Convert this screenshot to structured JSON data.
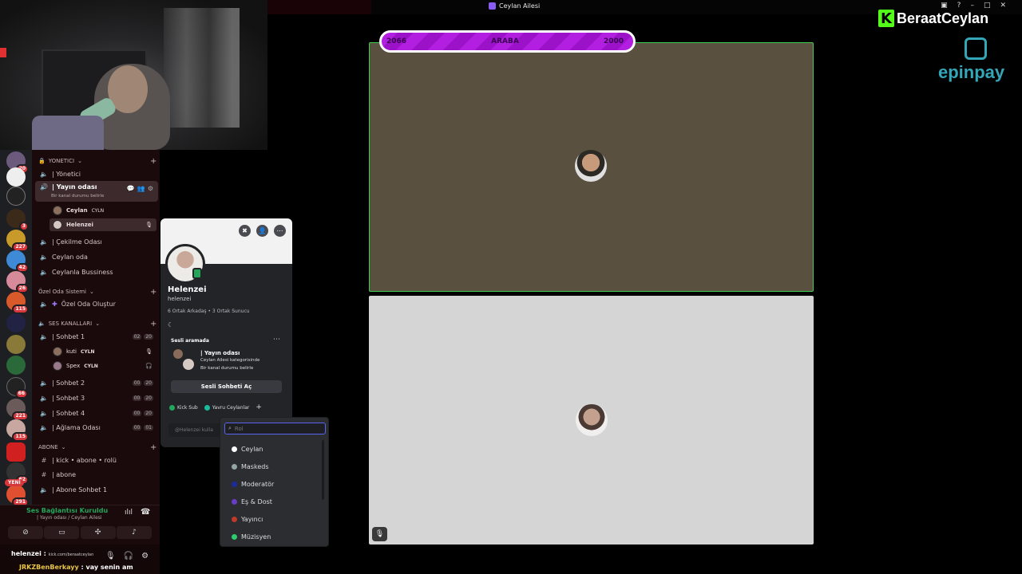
{
  "window": {
    "title": "Ceylan Ailesi"
  },
  "channels": {
    "cat_yonetici": "YONETICI",
    "ch_yonetici": "| Yönetici",
    "ch_yayin": "| Yayın odası",
    "ch_yayin_status": "Bir kanal durumu belirle",
    "member1": "Ceylan",
    "member1_tag": "CYLN",
    "member2": "Helenzei",
    "ch_cekilme": "| Çekilme Odası",
    "ch_ceylan_oda": "Ceylan oda",
    "ch_bussiness": "Ceylanla Bussiness",
    "cat_ozel": "Özel Oda Sistemi",
    "ch_ozel": "Özel Oda Oluştur",
    "cat_ses": "SES KANALLARI",
    "ch_sohbet1": "| Sohbet 1",
    "ch_sohbet1_cnt_a": "02",
    "ch_sohbet1_cnt_b": "20",
    "member3": "kuti",
    "member3_tag": "CYLN",
    "member4": "Spex",
    "member4_tag": "CYLN",
    "ch_sohbet2": "| Sohbet 2",
    "ch_sohbet2_cnt_a": "00",
    "ch_sohbet2_cnt_b": "20",
    "ch_sohbet3": "| Sohbet 3",
    "ch_sohbet3_cnt_a": "00",
    "ch_sohbet3_cnt_b": "20",
    "ch_sohbet4": "| Sohbet 4",
    "ch_sohbet4_cnt_a": "00",
    "ch_sohbet4_cnt_b": "20",
    "ch_aglama": "| Ağlama Odası",
    "ch_aglama_cnt_a": "00",
    "ch_aglama_cnt_b": "01",
    "cat_abone": "ABONE",
    "ch_kick": "| kick • abone • rolü",
    "ch_abone": "| abone",
    "ch_abone_sohbet": "| Abone Sohbet 1"
  },
  "rail": {
    "badges": [
      "20",
      "3",
      "227",
      "42",
      "26",
      "115",
      "66",
      "221",
      "115",
      "62",
      "291"
    ],
    "new_label": "YENİ"
  },
  "voice": {
    "status": "Ses Bağlantısı Kuruldu",
    "location": "| Yayın odası / Ceylan Ailesi"
  },
  "chat": {
    "line1_user": "helenzei :",
    "line1_url": "kick.com/beraatceylan",
    "line2_user": "JRKZBenBerkayy",
    "line2_msg": ": vay senin am"
  },
  "profile": {
    "name": "Helenzei",
    "username": "helenzei",
    "mutual": "6 Ortak Arkadaş • 3 Ortak Sunucu",
    "section": "Sesli aramada",
    "call_channel": "| Yayın odası",
    "call_category": "Ceylan Ailesi kategorisinde",
    "call_status": "Bir kanal durumu belirle",
    "join_button": "Sesli Sohbeti Aç",
    "role1": "Kick Sub",
    "role2": "Yavru Ceylanlar",
    "message_placeholder": "@Helenzei kulla"
  },
  "role_dropdown": {
    "search_placeholder": "Rol",
    "items": [
      {
        "label": "Ceylan",
        "color": "#ffffff"
      },
      {
        "label": "Maskeds",
        "color": "#95a5a6"
      },
      {
        "label": "Moderatör",
        "color": "#1e2a9a"
      },
      {
        "label": "Eş & Dost",
        "color": "#6a3ec4"
      },
      {
        "label": "Yayıncı",
        "color": "#c0392b"
      },
      {
        "label": "Müzisyen",
        "color": "#2ecc71"
      }
    ]
  },
  "stream_banner": {
    "left": "2066",
    "center": "ARABA",
    "right": "2000"
  },
  "brand": {
    "kick_name": "BeraatCeylan",
    "sponsor": "epinpay"
  }
}
